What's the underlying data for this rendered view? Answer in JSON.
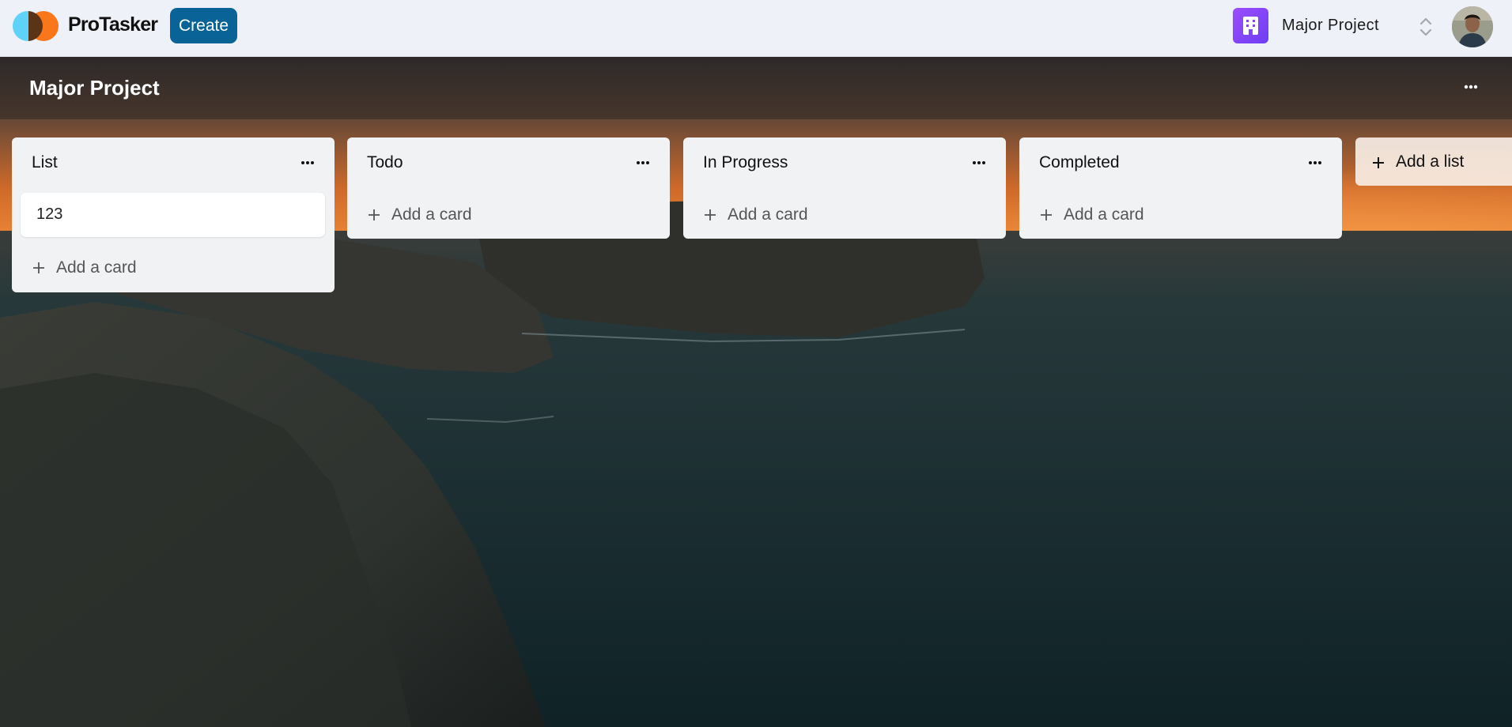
{
  "app": {
    "name": "ProTasker",
    "create_label": "Create"
  },
  "workspace": {
    "name": "Major Project",
    "icon": "building-icon",
    "accent": "#8e48fa"
  },
  "user": {
    "avatar": "user-avatar"
  },
  "board": {
    "title": "Major Project",
    "background": "sunset-cliffs-sea-photo"
  },
  "lists": [
    {
      "title": "List",
      "cards": [
        "123"
      ],
      "add_card_label": "Add a card"
    },
    {
      "title": "Todo",
      "cards": [],
      "add_card_label": "Add a card"
    },
    {
      "title": "In Progress",
      "cards": [],
      "add_card_label": "Add a card"
    },
    {
      "title": "Completed",
      "cards": [],
      "add_card_label": "Add a card"
    }
  ],
  "add_list_label": "Add a list",
  "colors": {
    "navbar_bg": "#eef2f8",
    "create_button": "#0a6396",
    "list_bg": "#f1f2f4"
  }
}
